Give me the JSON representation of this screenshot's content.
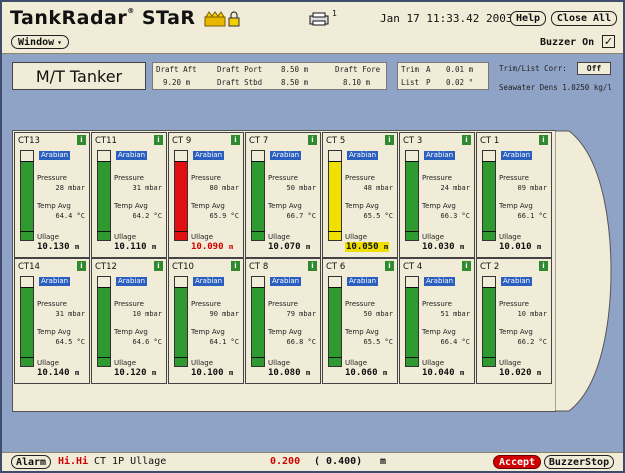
{
  "header": {
    "app_title": "TankRadar",
    "app_title_suffix": "STaR",
    "trademark": "®",
    "printer_count": "1",
    "datetime": "Jan 17 11:33.42 2003",
    "help_label": "Help",
    "close_all_label": "Close All",
    "window_menu_label": "Window",
    "buzzer_label": "Buzzer On",
    "buzzer_checked": "✓"
  },
  "info": {
    "ship_name": "M/T Tanker",
    "draft_aft_label": "Draft Aft",
    "draft_aft_value": "9.20 m",
    "draft_port_label": "Draft Port",
    "draft_port_value": "8.50 m",
    "draft_stbd_label": "Draft Stbd",
    "draft_stbd_value": "8.50 m",
    "draft_fore_label": "Draft Fore",
    "draft_fore_value": "8.10 m",
    "trim_label": "Trim",
    "trim_dir": "A",
    "trim_value": "0.01 m",
    "list_label": "List",
    "list_dir": "P",
    "list_value": "0.02 °",
    "corr_label": "Trim/List Corr:",
    "corr_value": "Off",
    "density_label": "Seawater Dens 1.0250 kg/l"
  },
  "labels": {
    "pressure": "Pressure",
    "temp_avg": "Temp Avg",
    "ullage": "Ullage",
    "info_icon": "i"
  },
  "tanks_top": [
    {
      "name": "CT13",
      "cargo": "Arabian",
      "pressure": "28 mbar",
      "temp": "64.4 °C",
      "ullage": "10.130",
      "unit": "m",
      "level": 0.88,
      "color": "#2f9a2f",
      "alarm": ""
    },
    {
      "name": "CT11",
      "cargo": "Arabian",
      "pressure": "31 mbar",
      "temp": "64.2 °C",
      "ullage": "10.110",
      "unit": "m",
      "level": 0.88,
      "color": "#2f9a2f",
      "alarm": ""
    },
    {
      "name": "CT 9",
      "cargo": "Arabian",
      "pressure": "80 mbar",
      "temp": "65.9 °C",
      "ullage": "10.090",
      "unit": "m",
      "level": 0.88,
      "color": "#e01010",
      "alarm": "red"
    },
    {
      "name": "CT 7",
      "cargo": "Arabian",
      "pressure": "50 mbar",
      "temp": "66.7 °C",
      "ullage": "10.070",
      "unit": "m",
      "level": 0.88,
      "color": "#2f9a2f",
      "alarm": ""
    },
    {
      "name": "CT 5",
      "cargo": "Arabian",
      "pressure": "48 mbar",
      "temp": "65.5 °C",
      "ullage": "10.050",
      "unit": "m",
      "level": 0.88,
      "color": "#f0e000",
      "alarm": "yellow"
    },
    {
      "name": "CT 3",
      "cargo": "Arabian",
      "pressure": "24 mbar",
      "temp": "66.3 °C",
      "ullage": "10.030",
      "unit": "m",
      "level": 0.88,
      "color": "#2f9a2f",
      "alarm": ""
    },
    {
      "name": "CT 1",
      "cargo": "Arabian",
      "pressure": "09 mbar",
      "temp": "66.1 °C",
      "ullage": "10.010",
      "unit": "m",
      "level": 0.88,
      "color": "#2f9a2f",
      "alarm": ""
    }
  ],
  "tanks_bottom": [
    {
      "name": "CT14",
      "cargo": "Arabian",
      "pressure": "31 mbar",
      "temp": "64.5 °C",
      "ullage": "10.140",
      "unit": "m",
      "level": 0.88,
      "color": "#2f9a2f",
      "alarm": ""
    },
    {
      "name": "CT12",
      "cargo": "Arabian",
      "pressure": "10 mbar",
      "temp": "64.6 °C",
      "ullage": "10.120",
      "unit": "m",
      "level": 0.88,
      "color": "#2f9a2f",
      "alarm": ""
    },
    {
      "name": "CT10",
      "cargo": "Arabian",
      "pressure": "90 mbar",
      "temp": "64.1 °C",
      "ullage": "10.100",
      "unit": "m",
      "level": 0.88,
      "color": "#2f9a2f",
      "alarm": ""
    },
    {
      "name": "CT 8",
      "cargo": "Arabian",
      "pressure": "79 mbar",
      "temp": "66.8 °C",
      "ullage": "10.080",
      "unit": "m",
      "level": 0.88,
      "color": "#2f9a2f",
      "alarm": ""
    },
    {
      "name": "CT 6",
      "cargo": "Arabian",
      "pressure": "50 mbar",
      "temp": "65.5 °C",
      "ullage": "10.060",
      "unit": "m",
      "level": 0.88,
      "color": "#2f9a2f",
      "alarm": ""
    },
    {
      "name": "CT 4",
      "cargo": "Arabian",
      "pressure": "51 mbar",
      "temp": "66.4 °C",
      "ullage": "10.040",
      "unit": "m",
      "level": 0.88,
      "color": "#2f9a2f",
      "alarm": ""
    },
    {
      "name": "CT 2",
      "cargo": "Arabian",
      "pressure": "10 mbar",
      "temp": "66.2 °C",
      "ullage": "10.020",
      "unit": "m",
      "level": 0.88,
      "color": "#2f9a2f",
      "alarm": ""
    }
  ],
  "bottom": {
    "alarm_label": "Alarm",
    "alarm_level": "Hi.Hi",
    "alarm_source": "CT 1P Ullage",
    "alarm_value": "0.200",
    "alarm_limit": "( 0.400)",
    "alarm_unit": "m",
    "accept_label": "Accept",
    "buzzer_stop_label": "BuzzerStop"
  },
  "colors": {
    "panel": "#f1ecd8",
    "background": "#8fa3c6",
    "cargo_tag": "#2a5fbf",
    "level_normal": "#2f9a2f",
    "level_alarm": "#e01010",
    "level_warning": "#f0e000"
  }
}
